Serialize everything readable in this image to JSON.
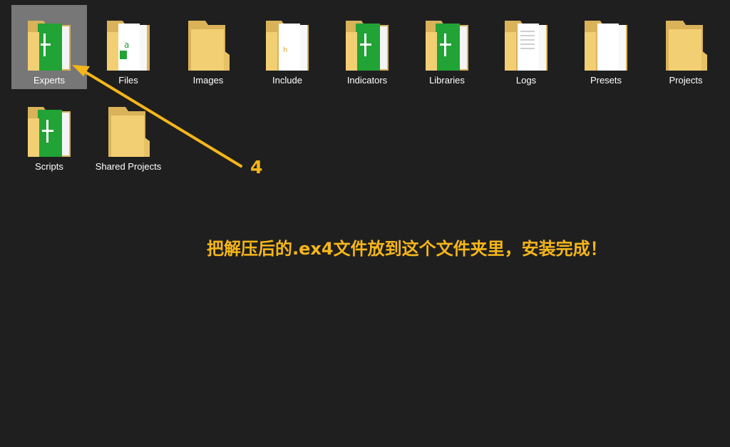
{
  "folders": [
    {
      "label": "Experts",
      "icon": "folder-mq-green-icon"
    },
    {
      "label": "Files",
      "icon": "folder-documents-icon"
    },
    {
      "label": "Images",
      "icon": "folder-empty-icon"
    },
    {
      "label": "Include",
      "icon": "folder-documents-icon"
    },
    {
      "label": "Indicators",
      "icon": "folder-mq-green-icon"
    },
    {
      "label": "Libraries",
      "icon": "folder-mq-green-icon"
    },
    {
      "label": "Logs",
      "icon": "folder-documents-icon"
    },
    {
      "label": "Presets",
      "icon": "folder-documents-icon"
    },
    {
      "label": "Projects",
      "icon": "folder-empty-icon"
    },
    {
      "label": "Scripts",
      "icon": "folder-mq-green-icon"
    },
    {
      "label": "Shared Projects",
      "icon": "folder-empty-icon"
    }
  ],
  "selected_folder": "Experts",
  "annotation": {
    "step_number": "4",
    "instruction": "把解压后的.ex4文件放到这个文件夹里，安装完成！"
  },
  "colors": {
    "background": "#1f1f1f",
    "selection": "#777777",
    "folder": "#f2cf72",
    "folder_dark": "#d9b25a",
    "mq_green": "#21a336",
    "annotation": "#f5b61a",
    "label": "#ffffff"
  }
}
